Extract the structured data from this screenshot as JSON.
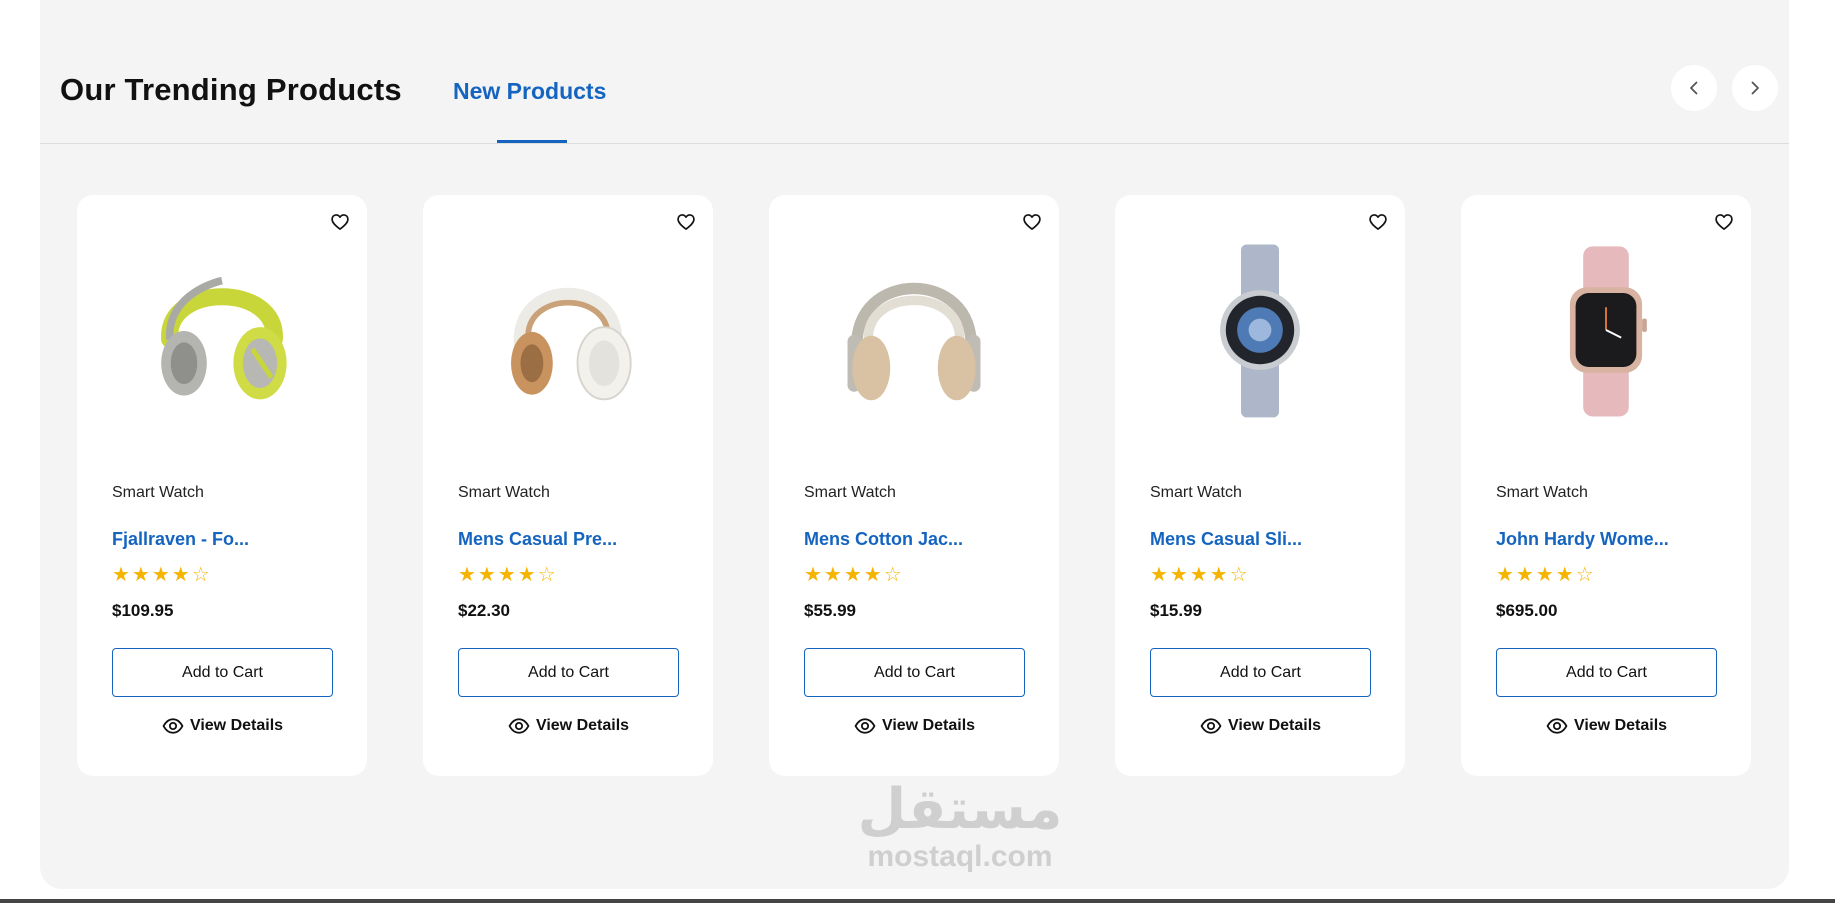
{
  "section": {
    "title": "Our Trending Products",
    "tab_label": "New Products"
  },
  "colors": {
    "accent": "#1565c0",
    "star": "#f5b400",
    "panel_bg": "#f4f4f4"
  },
  "products": [
    {
      "category": "Smart Watch",
      "name": "Fjallraven - Fo...",
      "rating": 4,
      "stars": "★★★★☆",
      "price": "$109.95",
      "cart_label": "Add to Cart",
      "details_label": "View Details",
      "image": "green-headphones"
    },
    {
      "category": "Smart Watch",
      "name": "Mens Casual Pre...",
      "rating": 4,
      "stars": "★★★★☆",
      "price": "$22.30",
      "cart_label": "Add to Cart",
      "details_label": "View Details",
      "image": "white-headphones"
    },
    {
      "category": "Smart Watch",
      "name": "Mens Cotton Jac...",
      "rating": 4,
      "stars": "★★★★☆",
      "price": "$55.99",
      "cart_label": "Add to Cart",
      "details_label": "View Details",
      "image": "beige-headphones"
    },
    {
      "category": "Smart Watch",
      "name": "Mens Casual Sli...",
      "rating": 4,
      "stars": "★★★★☆",
      "price": "$15.99",
      "cart_label": "Add to Cart",
      "details_label": "View Details",
      "image": "round-smartwatch"
    },
    {
      "category": "Smart Watch",
      "name": "John Hardy Wome...",
      "rating": 4,
      "stars": "★★★★☆",
      "price": "$695.00",
      "cart_label": "Add to Cart",
      "details_label": "View Details",
      "image": "pink-smartwatch"
    }
  ],
  "watermark": {
    "arabic": "مستقل",
    "latin": "mostaql.com"
  }
}
